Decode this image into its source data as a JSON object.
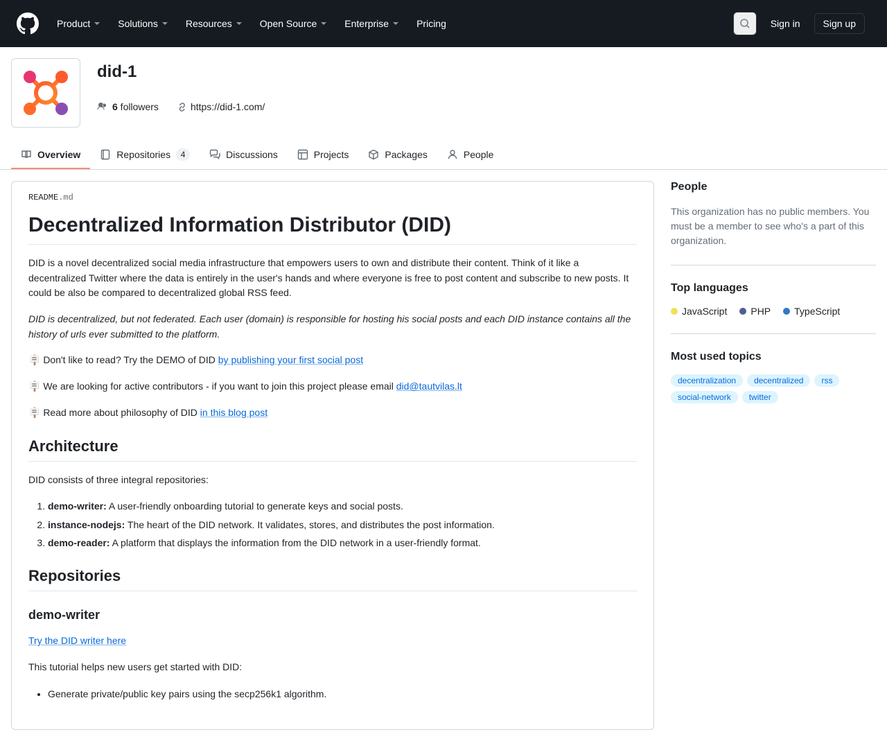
{
  "header": {
    "nav": [
      "Product",
      "Solutions",
      "Resources",
      "Open Source",
      "Enterprise",
      "Pricing"
    ],
    "signin": "Sign in",
    "signup": "Sign up"
  },
  "org": {
    "name": "did-1",
    "followers_count": "6",
    "followers_label": " followers",
    "website": "https://did-1.com/"
  },
  "tabs": {
    "overview": "Overview",
    "repositories": "Repositories",
    "repositories_count": "4",
    "discussions": "Discussions",
    "projects": "Projects",
    "packages": "Packages",
    "people": "People"
  },
  "readme": {
    "file_prefix": "README",
    "file_ext": ".md",
    "h1": "Decentralized Information Distributor (DID)",
    "p1": "DID is a novel decentralized social media infrastructure that empowers users to own and distribute their content. Think of it like a decentralized Twitter where the data is entirely in the user's hands and where everyone is free to post content and subscribe to new posts. It could be also be compared to decentralized global RSS feed.",
    "p2_em": "DID is decentralized, but not federated. Each user (domain) is responsible for hosting his social posts and each DID instance contains all the history of urls ever submitted to the platform.",
    "p3_pre": "🪧 Don't like to read? Try the DEMO of DID ",
    "p3_link": "by publishing your first social post",
    "p4_pre": "🪧 We are looking for active contributors - if you want to join this project please email ",
    "p4_link": "did@tautvilas.lt",
    "p5_pre": "🪧 Read more about philosophy of DID ",
    "p5_link": "in this blog post",
    "h2_arch": "Architecture",
    "arch_intro": "DID consists of three integral repositories:",
    "arch_items": [
      {
        "name": "demo-writer:",
        "desc": " A user-friendly onboarding tutorial to generate keys and social posts."
      },
      {
        "name": "instance-nodejs:",
        "desc": " The heart of the DID network. It validates, stores, and distributes the post information."
      },
      {
        "name": "demo-reader:",
        "desc": " A platform that displays the information from the DID network in a user-friendly format."
      }
    ],
    "h2_repos": "Repositories",
    "h3_demowriter": "demo-writer",
    "writer_link": "Try the DID writer here",
    "writer_p": "This tutorial helps new users get started with DID:",
    "writer_bullets": [
      "Generate private/public key pairs using the secp256k1 algorithm."
    ]
  },
  "sidebar": {
    "people_title": "People",
    "people_text": "This organization has no public members. You must be a member to see who's a part of this organization.",
    "langs_title": "Top languages",
    "langs": [
      {
        "name": "JavaScript",
        "color": "#f1e05a"
      },
      {
        "name": "PHP",
        "color": "#4F5D95"
      },
      {
        "name": "TypeScript",
        "color": "#3178c6"
      }
    ],
    "topics_title": "Most used topics",
    "topics": [
      "decentralization",
      "decentralized",
      "rss",
      "social-network",
      "twitter"
    ]
  }
}
